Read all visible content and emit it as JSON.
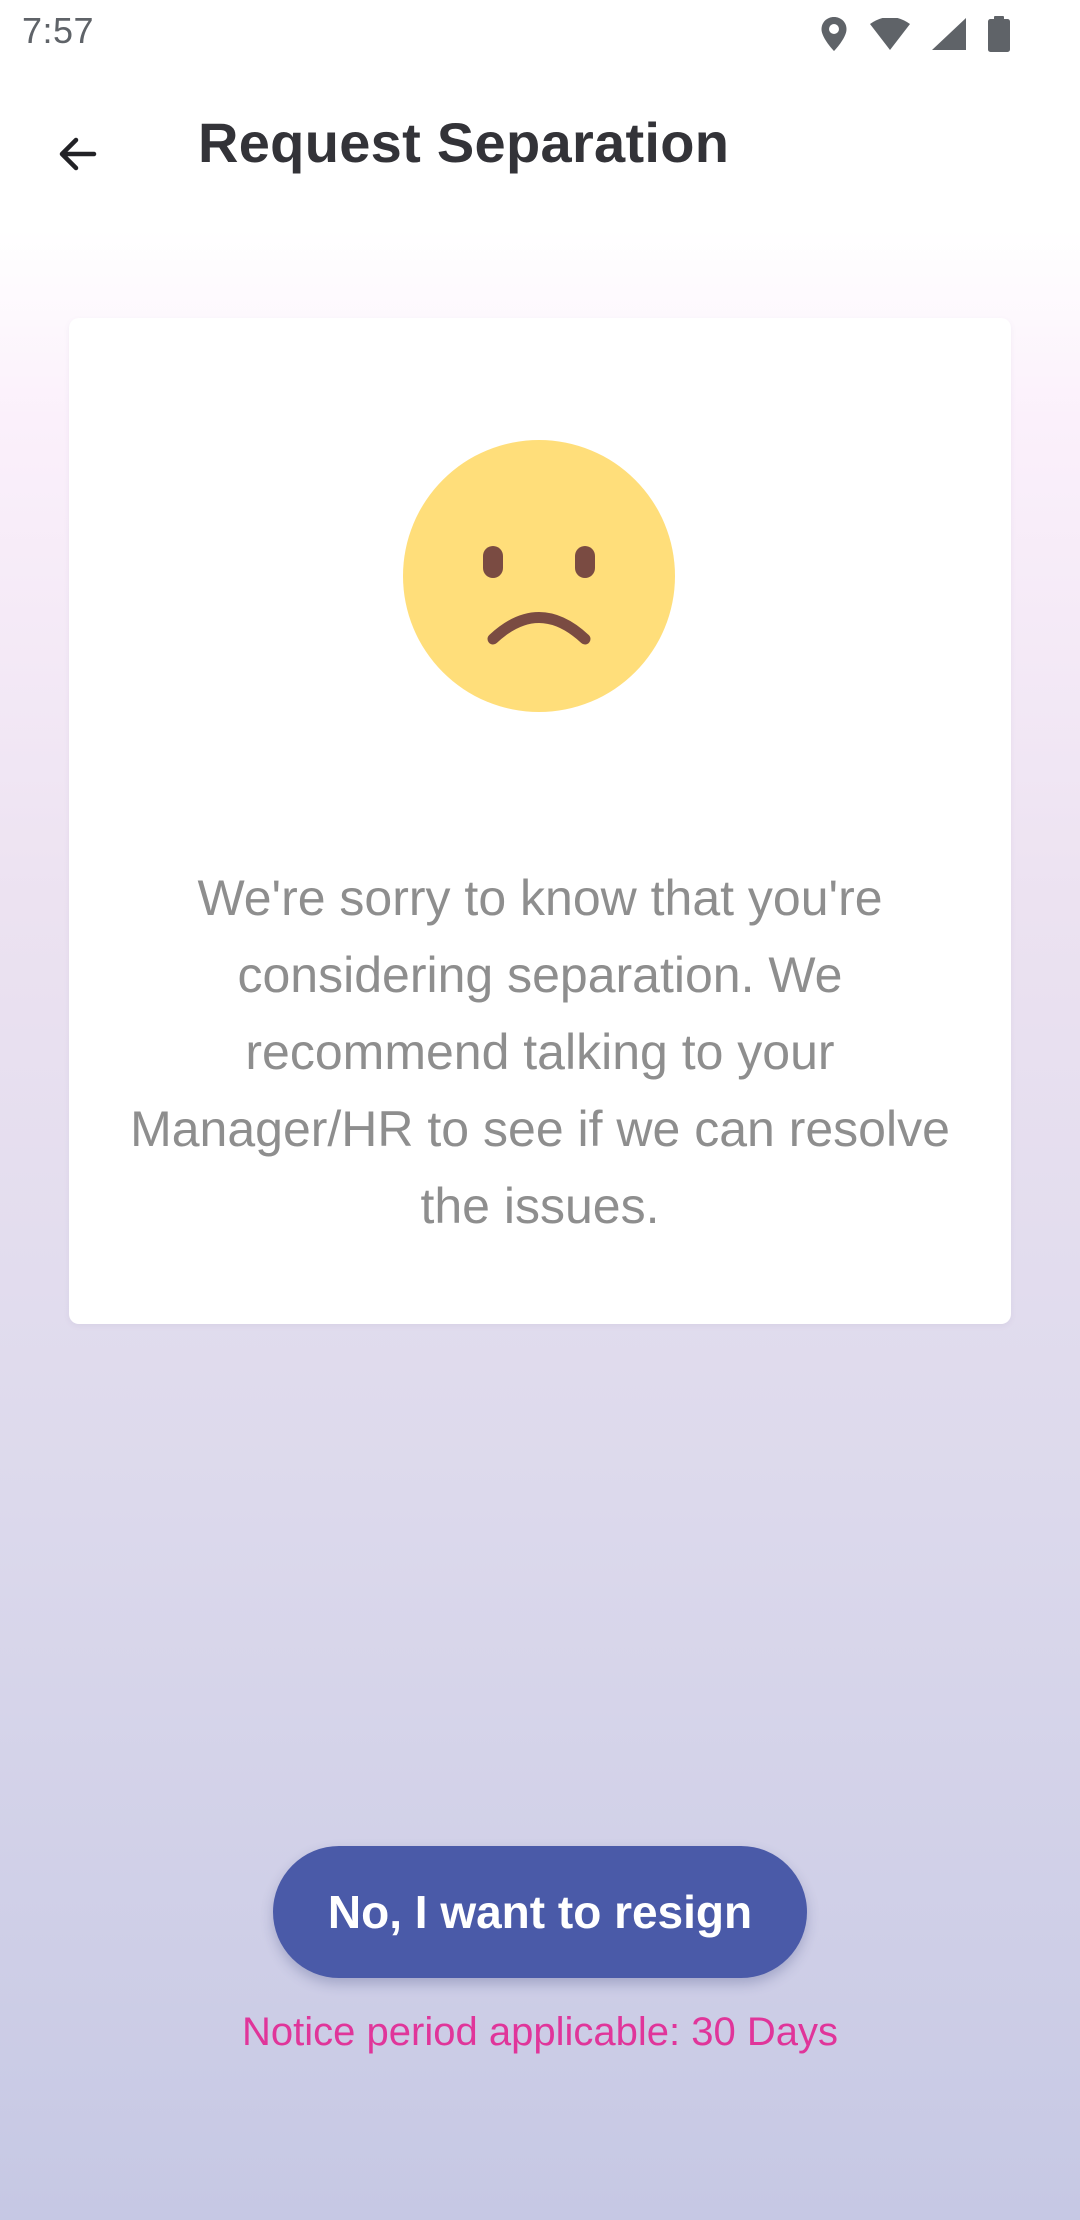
{
  "status_bar": {
    "time": "7:57",
    "icons": [
      "location-icon",
      "wifi-icon",
      "signal-icon",
      "battery-icon"
    ]
  },
  "app_bar": {
    "back_icon": "arrow-left-icon",
    "title": "Request Separation"
  },
  "card": {
    "illustration": "sad-face-icon",
    "message": "We're sorry to know that you're considering separation. We recommend talking to your Manager/HR to see if we can resolve the issues."
  },
  "actions": {
    "resign_label": "No, I want to resign"
  },
  "notice": {
    "text": "Notice period applicable: 30 Days"
  },
  "colors": {
    "primary_button": "#4a5aa8",
    "notice_accent": "#e0359a",
    "face_yellow": "#ffde7a",
    "face_features": "#7a4b42"
  }
}
